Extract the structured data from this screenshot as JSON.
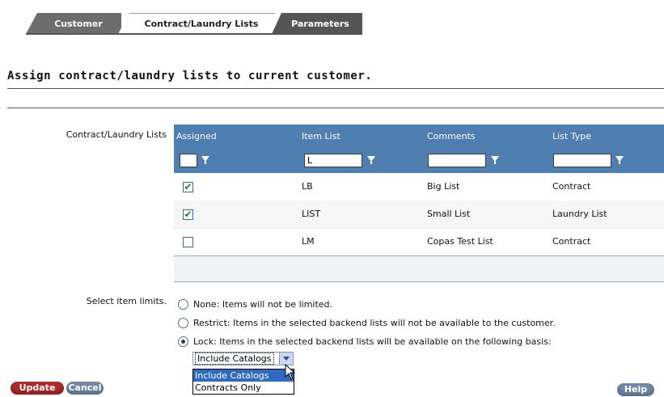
{
  "tabs": [
    {
      "label": "Customer",
      "active": false
    },
    {
      "label": "Contract/Laundry Lists",
      "active": true
    },
    {
      "label": "Parameters",
      "active": false
    }
  ],
  "page_title": "Assign contract/laundry lists to current customer.",
  "lists_section_label": "Contract/Laundry Lists",
  "grid": {
    "columns": [
      "Assigned",
      "Item List",
      "Comments",
      "List Type"
    ],
    "filters": [
      "",
      "L",
      "",
      ""
    ],
    "rows": [
      {
        "assigned": true,
        "item_list": "LB",
        "comments": "Big List",
        "list_type": "Contract"
      },
      {
        "assigned": true,
        "item_list": "LIST",
        "comments": "Small List",
        "list_type": "Laundry List"
      },
      {
        "assigned": false,
        "item_list": "LM",
        "comments": "Copas Test List",
        "list_type": "Contract"
      }
    ],
    "header_color": "#4e7fb0",
    "check_color": "#1b8a1b"
  },
  "limits_label": "Select item limits.",
  "limit_options": [
    {
      "label": "None: Items will not be limited.",
      "selected": false
    },
    {
      "label": "Restrict: Items in the selected backend lists will not be available to the customer.",
      "selected": false
    },
    {
      "label": "Lock: Items in the selected backend lists will be available on the following basis:",
      "selected": true
    }
  ],
  "basis_select": {
    "value": "Include Catalogs",
    "options": [
      "Include Catalogs",
      "Contracts Only"
    ],
    "highlighted": "Include Catalogs"
  },
  "buttons": {
    "update": "Update",
    "cancel": "Cancel",
    "help": "Help"
  },
  "colors": {
    "update_button": "#b12a2a",
    "secondary_button": "#6f8aa6",
    "tab_dark": "#6d6d6d"
  },
  "icons": [
    "filter-funnel-icon",
    "checkbox-checked-icon",
    "radio-icon",
    "dropdown-arrow-icon",
    "mouse-pointer-icon"
  ]
}
